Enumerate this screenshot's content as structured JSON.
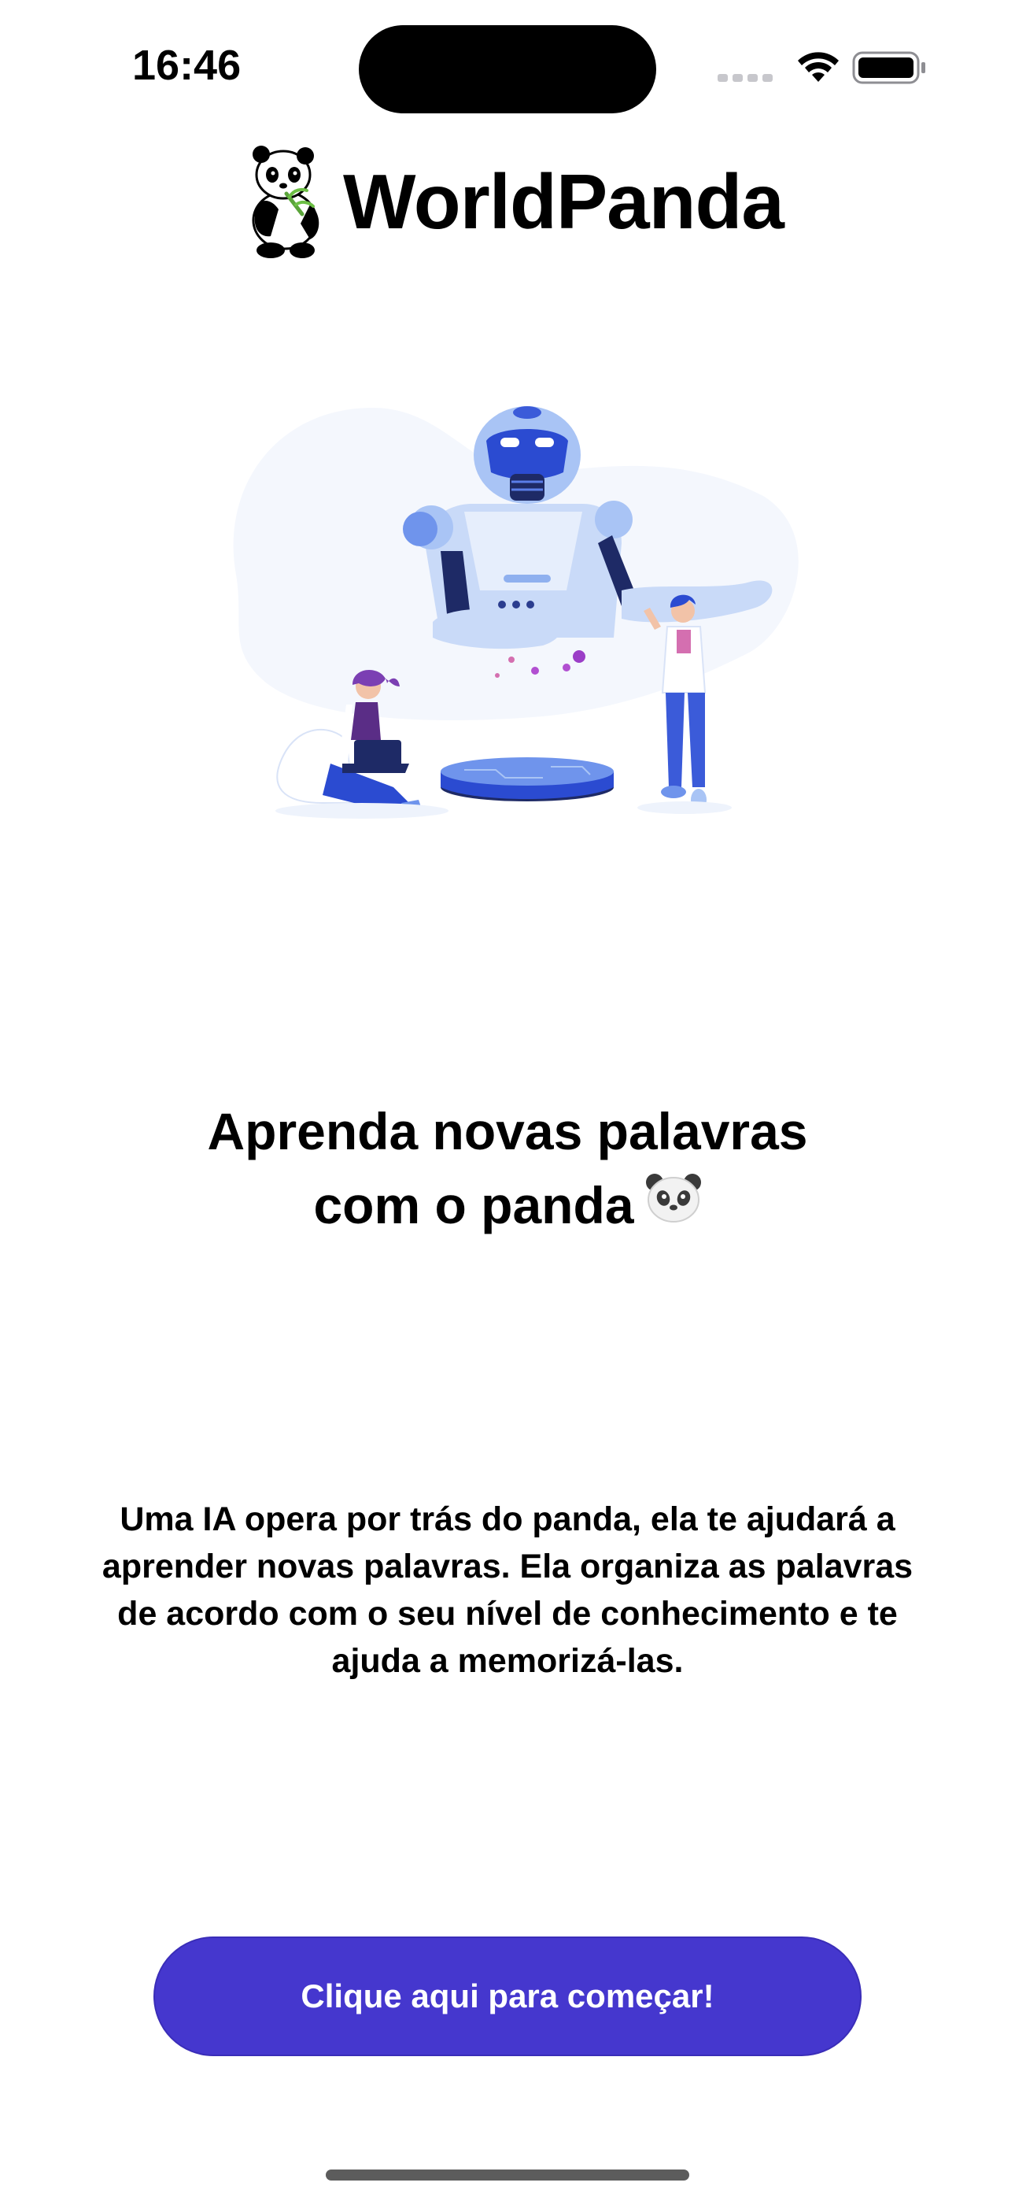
{
  "status_bar": {
    "time": "16:46"
  },
  "header": {
    "app_title": "WorldPanda",
    "logo_icon": "panda-logo-icon"
  },
  "hero": {
    "illustration": "robot-scientists-illustration"
  },
  "headline": {
    "line1": "Aprenda novas palavras",
    "line2": "com o panda"
  },
  "description": {
    "line1": "Uma IA opera por trás do panda, ela te ajudará a",
    "line2": "aprender novas palavras. Ela organiza as palavras",
    "line3": "de acordo com o seu nível de conhecimento e te",
    "line4": "ajuda a memorizá-las."
  },
  "cta": {
    "label": "Clique aqui para começar!"
  },
  "colors": {
    "accent": "#4537ce",
    "illustration_blue": "#3b5bd9",
    "illustration_light": "#a9c4f5",
    "background": "#ffffff"
  }
}
